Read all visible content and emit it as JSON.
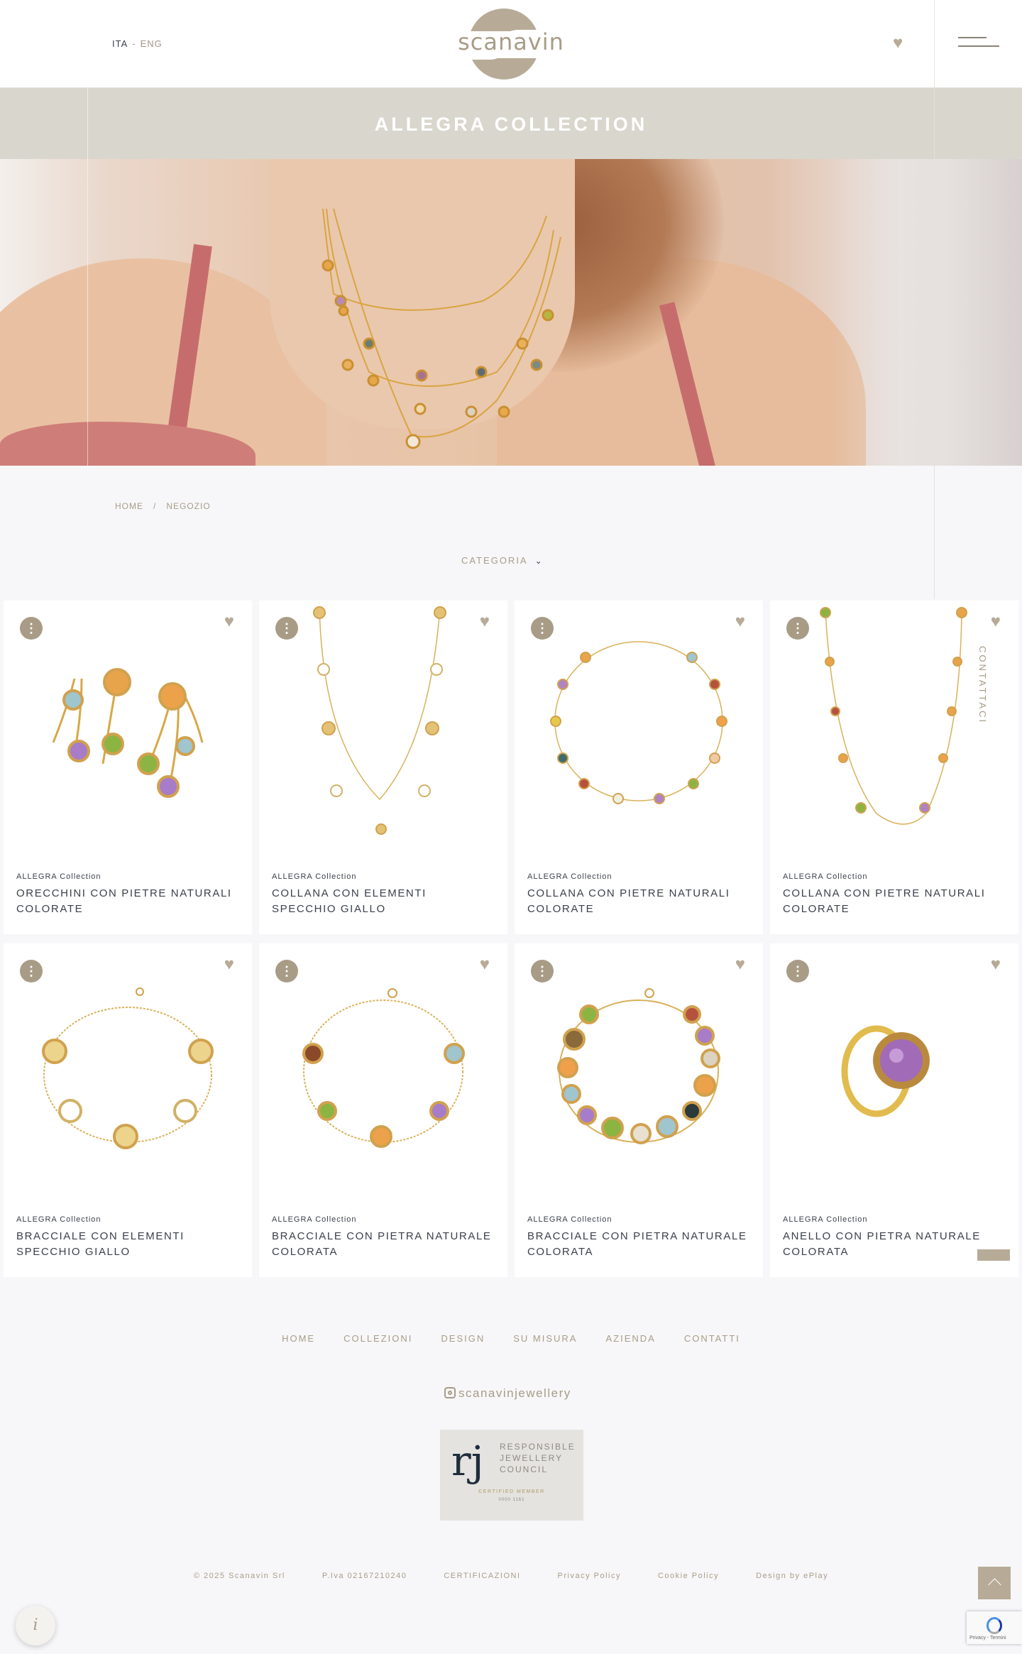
{
  "header": {
    "lang_ita": "ITA",
    "lang_sep": "-",
    "lang_eng": "ENG",
    "logo_text": "scanavin"
  },
  "page_title": "ALLEGRA COLLECTION",
  "breadcrumb": {
    "home": "HOME",
    "sep": "/",
    "current": "NEGOZIO"
  },
  "filter": {
    "category_label": "CATEGORIA"
  },
  "side_tab": "CONTATTACI",
  "products": [
    {
      "collection": "ALLEGRA Collection",
      "name": "ORECCHINI CON PIETRE NATURALI COLORATE"
    },
    {
      "collection": "ALLEGRA Collection",
      "name": "COLLANA CON ELEMENTI SPECCHIO GIALLO"
    },
    {
      "collection": "ALLEGRA Collection",
      "name": "COLLANA CON PIETRE NATURALI COLORATE"
    },
    {
      "collection": "ALLEGRA Collection",
      "name": "COLLANA CON PIETRE NATURALI COLORATE"
    },
    {
      "collection": "ALLEGRA Collection",
      "name": "BRACCIALE CON ELEMENTI SPECCHIO GIALLO"
    },
    {
      "collection": "ALLEGRA Collection",
      "name": "BRACCIALE CON PIETRA NATURALE COLORATA"
    },
    {
      "collection": "ALLEGRA Collection",
      "name": "BRACCIALE CON PIETRA NATURALE COLORATA"
    },
    {
      "collection": "ALLEGRA Collection",
      "name": "ANELLO CON PIETRA NATURALE COLORATA"
    }
  ],
  "footer": {
    "nav": [
      "HOME",
      "COLLEZIONI",
      "DESIGN",
      "SU MISURA",
      "AZIENDA",
      "CONTATTI"
    ],
    "instagram": "scanavinjewellery",
    "rjc_mark": "rj",
    "rjc_text_1": "RESPONSIBLE",
    "rjc_text_2": "JEWELLERY",
    "rjc_text_3": "COUNCIL",
    "rjc_certified": "CERTIFIED MEMBER",
    "rjc_number": "0000 1161",
    "copyright": "© 2025 Scanavin Srl",
    "vat": "P.Iva 02167210240",
    "certifications": "CERTIFICAZIONI",
    "privacy": "Privacy Policy",
    "cookie": "Cookie Policy",
    "design_by": "Design by ePlay"
  },
  "widgets": {
    "info_symbol": "i",
    "recaptcha_text": "Privacy - Termini"
  },
  "colors": {
    "accent": "#b7ab97",
    "accent_text": "#a89c87",
    "title_band": "#d9d6cd",
    "text_dark": "#3a3f4a"
  },
  "icons": {
    "favorite": "heart-icon",
    "info": "info-dots-icon",
    "menu": "hamburger-icon",
    "dropdown": "chevron-down-icon",
    "instagram": "instagram-icon",
    "to_top": "chevron-up-icon"
  }
}
